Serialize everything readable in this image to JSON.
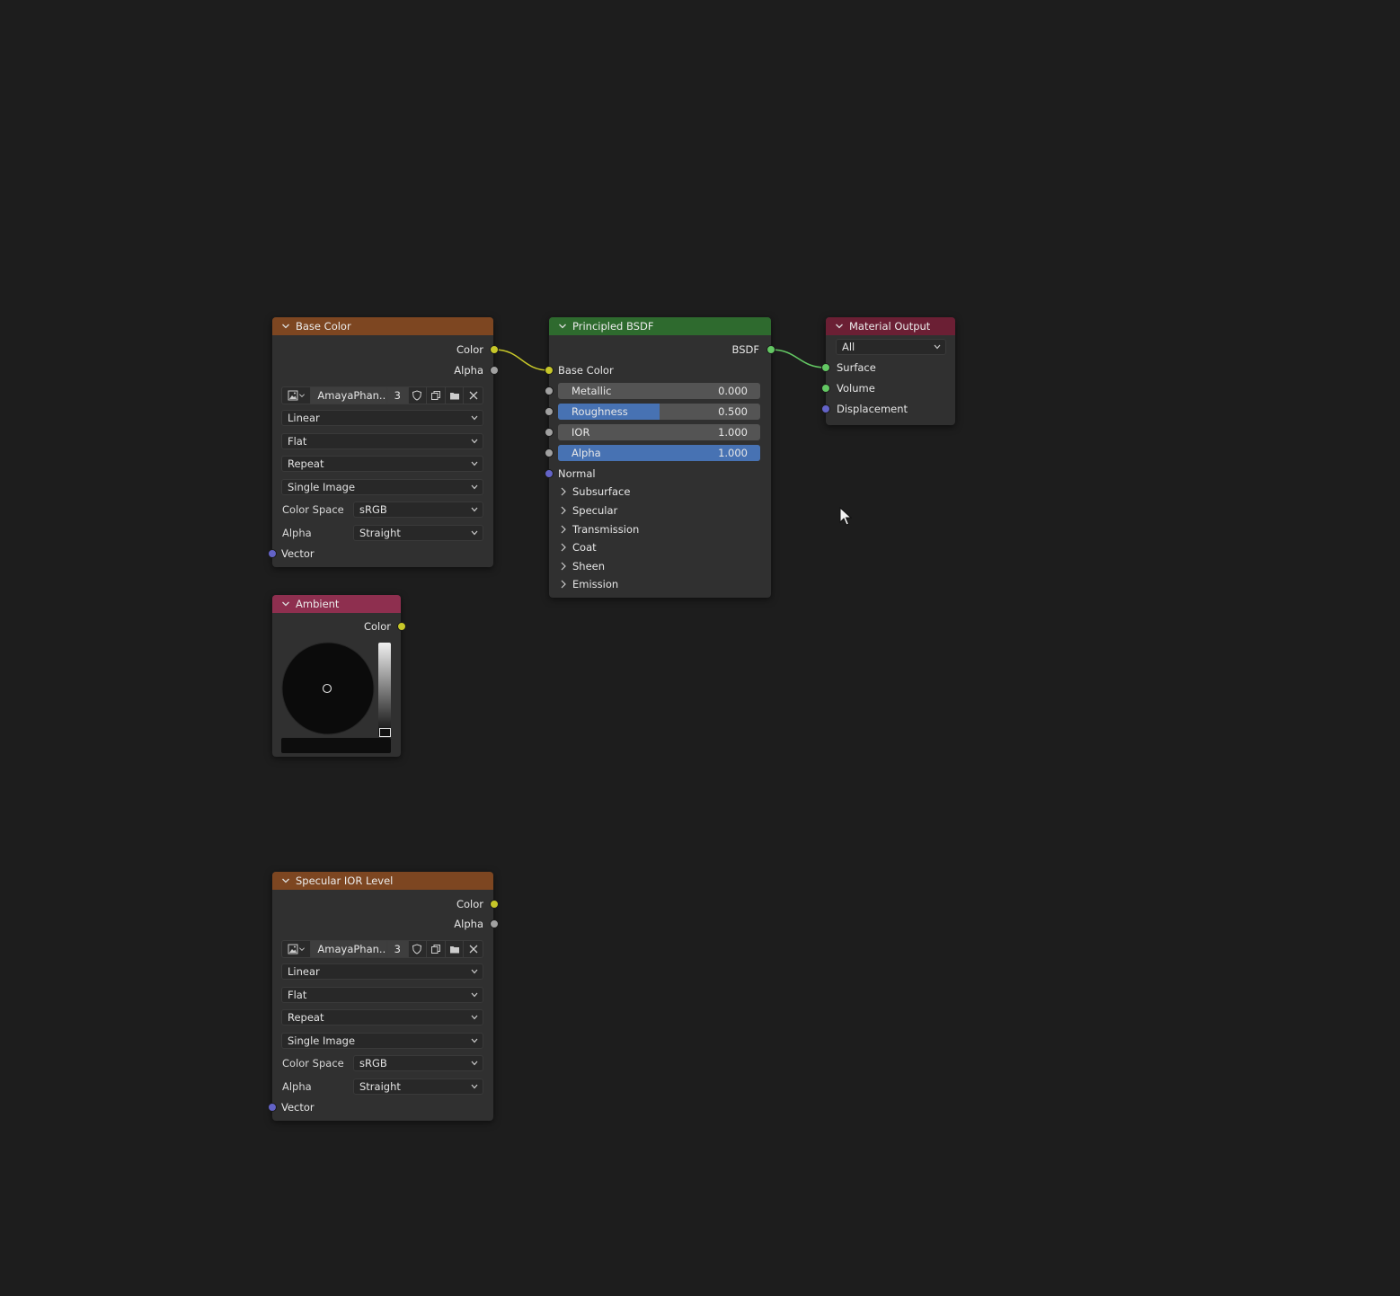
{
  "nodes": {
    "base_color": {
      "title": "Base Color",
      "out_color": "Color",
      "out_alpha": "Alpha",
      "image_name": "AmayaPhan...",
      "user_count": "3",
      "interpolation": "Linear",
      "projection": "Flat",
      "extension": "Repeat",
      "source": "Single Image",
      "color_space_label": "Color Space",
      "color_space": "sRGB",
      "alpha_label": "Alpha",
      "alpha_mode": "Straight",
      "in_vector": "Vector"
    },
    "principled": {
      "title": "Principled BSDF",
      "out_bsdf": "BSDF",
      "base_color": "Base Color",
      "metallic_label": "Metallic",
      "metallic_value": "0.000",
      "metallic_fill": 0.0,
      "roughness_label": "Roughness",
      "roughness_value": "0.500",
      "roughness_fill": 0.5,
      "ior_label": "IOR",
      "ior_value": "1.000",
      "ior_fill": 0.0,
      "alpha_label": "Alpha",
      "alpha_value": "1.000",
      "alpha_fill": 1.0,
      "normal": "Normal",
      "panels": [
        "Subsurface",
        "Specular",
        "Transmission",
        "Coat",
        "Sheen",
        "Emission"
      ]
    },
    "material_output": {
      "title": "Material Output",
      "target": "All",
      "surface": "Surface",
      "volume": "Volume",
      "displacement": "Displacement"
    },
    "ambient": {
      "title": "Ambient",
      "out_color": "Color",
      "swatch_color": "#0d0d0d"
    },
    "specular_ior": {
      "title": "Specular IOR Level",
      "out_color": "Color",
      "out_alpha": "Alpha",
      "image_name": "AmayaPhan...",
      "user_count": "3",
      "interpolation": "Linear",
      "projection": "Flat",
      "extension": "Repeat",
      "source": "Single Image",
      "color_space_label": "Color Space",
      "color_space": "sRGB",
      "alpha_label": "Alpha",
      "alpha_mode": "Straight",
      "in_vector": "Vector"
    }
  },
  "icons": {
    "image": "image-icon",
    "fake_user": "shield-icon",
    "duplicate": "duplicate-icon",
    "open": "folder-icon",
    "unlink": "close-icon"
  },
  "colors": {
    "texture_header": "#7d4621",
    "shader_header": "#2e6a2e",
    "output_header": "#6b1f34",
    "rgb_header": "#8e2f4f",
    "color_socket": "#c7c729",
    "float_socket": "#a1a1a1",
    "vector_socket": "#6363c7",
    "shader_socket": "#63c763",
    "slider_fill": "#4772b3"
  }
}
